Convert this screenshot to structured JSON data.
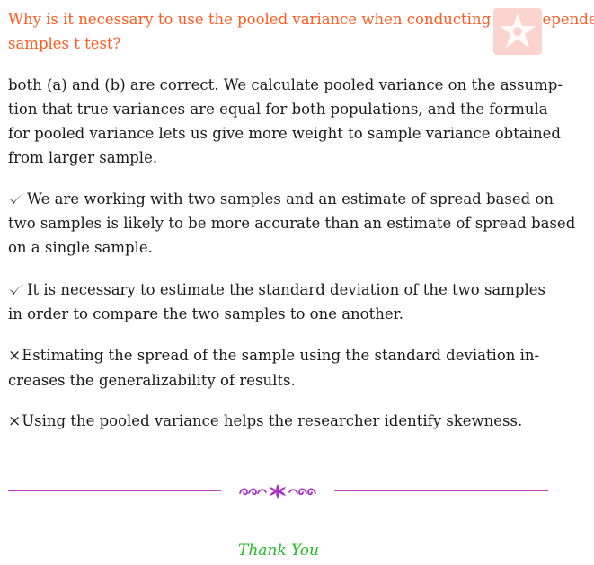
{
  "question": {
    "line1": "Why is it necessary to use the pooled variance when conducting an independent-",
    "line2": "samples t test?"
  },
  "explanation": {
    "lines": [
      "both (a) and (b) are correct.  We calculate pooled variance on the assump-",
      "tion that true variances are equal for both populations, and the formula",
      "for pooled variance lets us give more weight to sample variance obtained",
      "from larger sample."
    ]
  },
  "options": [
    {
      "correct": true,
      "lines": [
        "We are working with two samples and an estimate of spread based on",
        "two samples is likely to be more accurate than an estimate of spread based",
        "on a single sample."
      ]
    },
    {
      "correct": true,
      "lines": [
        "It is necessary to estimate the standard deviation of the two samples",
        "in order to compare the two samples to one another."
      ]
    },
    {
      "correct": false,
      "lines": [
        "Estimating the spread of the sample using the standard deviation in-",
        "creases the generalizability of results."
      ]
    },
    {
      "correct": false,
      "lines": [
        "Using the pooled variance helps the researcher identify skewness."
      ]
    }
  ],
  "marks": {
    "correct_icon": "check-mark-icon",
    "incorrect_icon": "cross-mark-icon",
    "incorrect_glyph": "×"
  },
  "footer": {
    "thanks": "Thank You"
  },
  "colors": {
    "question": "#ff5a1f",
    "rule": "#c23fc2",
    "ornament": "#a832c8",
    "thanks": "#22bb22",
    "watermark": "#fbd3cf"
  }
}
